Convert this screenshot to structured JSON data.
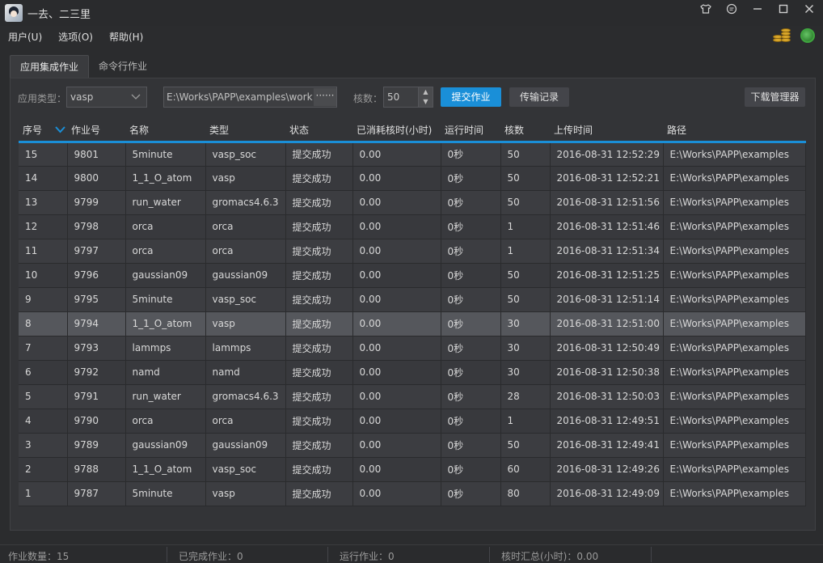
{
  "window": {
    "title": "一去、二三里"
  },
  "menu": [
    "用户(U)",
    "选项(O)",
    "帮助(H)"
  ],
  "tabs": [
    "应用集成作业",
    "命令行作业"
  ],
  "toolbar": {
    "app_type_label": "应用类型：",
    "app_type_value": "vasp",
    "path_value": "E:\\Works\\PAPP\\examples\\work",
    "browse_label": "······",
    "cores_label": "核数：",
    "cores_value": "50",
    "submit_label": "提交作业",
    "transfer_label": "传输记录",
    "download_label": "下载管理器"
  },
  "table": {
    "columns": [
      "序号",
      "作业号",
      "名称",
      "类型",
      "状态",
      "已消耗核时(小时)",
      "运行时间",
      "核数",
      "上传时间",
      "路径"
    ],
    "rows": [
      [
        "15",
        "9801",
        "5minute",
        "vasp_soc",
        "提交成功",
        "0.00",
        "0秒",
        "50",
        "2016-08-31 12:52:29",
        "E:\\Works\\PAPP\\examples"
      ],
      [
        "14",
        "9800",
        "1_1_O_atom",
        "vasp",
        "提交成功",
        "0.00",
        "0秒",
        "50",
        "2016-08-31 12:52:21",
        "E:\\Works\\PAPP\\examples"
      ],
      [
        "13",
        "9799",
        "run_water",
        "gromacs4.6.3",
        "提交成功",
        "0.00",
        "0秒",
        "50",
        "2016-08-31 12:51:56",
        "E:\\Works\\PAPP\\examples"
      ],
      [
        "12",
        "9798",
        "orca",
        "orca",
        "提交成功",
        "0.00",
        "0秒",
        "1",
        "2016-08-31 12:51:46",
        "E:\\Works\\PAPP\\examples"
      ],
      [
        "11",
        "9797",
        "orca",
        "orca",
        "提交成功",
        "0.00",
        "0秒",
        "1",
        "2016-08-31 12:51:34",
        "E:\\Works\\PAPP\\examples"
      ],
      [
        "10",
        "9796",
        "gaussian09",
        "gaussian09",
        "提交成功",
        "0.00",
        "0秒",
        "50",
        "2016-08-31 12:51:25",
        "E:\\Works\\PAPP\\examples"
      ],
      [
        "9",
        "9795",
        "5minute",
        "vasp_soc",
        "提交成功",
        "0.00",
        "0秒",
        "50",
        "2016-08-31 12:51:14",
        "E:\\Works\\PAPP\\examples"
      ],
      [
        "8",
        "9794",
        "1_1_O_atom",
        "vasp",
        "提交成功",
        "0.00",
        "0秒",
        "30",
        "2016-08-31 12:51:00",
        "E:\\Works\\PAPP\\examples"
      ],
      [
        "7",
        "9793",
        "lammps",
        "lammps",
        "提交成功",
        "0.00",
        "0秒",
        "30",
        "2016-08-31 12:50:49",
        "E:\\Works\\PAPP\\examples"
      ],
      [
        "6",
        "9792",
        "namd",
        "namd",
        "提交成功",
        "0.00",
        "0秒",
        "30",
        "2016-08-31 12:50:38",
        "E:\\Works\\PAPP\\examples"
      ],
      [
        "5",
        "9791",
        "run_water",
        "gromacs4.6.3",
        "提交成功",
        "0.00",
        "0秒",
        "28",
        "2016-08-31 12:50:03",
        "E:\\Works\\PAPP\\examples"
      ],
      [
        "4",
        "9790",
        "orca",
        "orca",
        "提交成功",
        "0.00",
        "0秒",
        "1",
        "2016-08-31 12:49:51",
        "E:\\Works\\PAPP\\examples"
      ],
      [
        "3",
        "9789",
        "gaussian09",
        "gaussian09",
        "提交成功",
        "0.00",
        "0秒",
        "50",
        "2016-08-31 12:49:41",
        "E:\\Works\\PAPP\\examples"
      ],
      [
        "2",
        "9788",
        "1_1_O_atom",
        "vasp_soc",
        "提交成功",
        "0.00",
        "0秒",
        "60",
        "2016-08-31 12:49:26",
        "E:\\Works\\PAPP\\examples"
      ],
      [
        "1",
        "9787",
        "5minute",
        "vasp",
        "提交成功",
        "0.00",
        "0秒",
        "80",
        "2016-08-31 12:49:09",
        "E:\\Works\\PAPP\\examples"
      ]
    ],
    "selected_row": 7
  },
  "status": {
    "job_count": "作业数量：15",
    "completed": "已完成作业：0",
    "running": "运行作业：0",
    "core_hours": "核时汇总(小时)：0.00"
  },
  "icons": {
    "title": [
      "shirt-icon",
      "message-icon",
      "minimize-icon",
      "maximize-icon",
      "close-icon"
    ],
    "menu_right": [
      "coins-icon",
      "globe-icon"
    ]
  }
}
